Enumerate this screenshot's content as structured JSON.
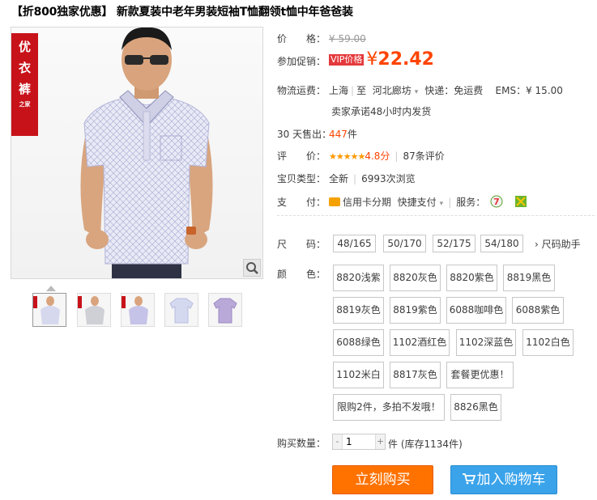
{
  "title": "【折800独家优惠】 新款夏装中老年男装短袖T恤翻领t恤中年爸爸装",
  "brand_tag": {
    "chars": [
      "优",
      "衣",
      "裤"
    ],
    "sub": "之家"
  },
  "price": {
    "label": "价　　格：",
    "original": "¥ 59.00"
  },
  "promo": {
    "label": "参加促销：",
    "badge": "VIP价格",
    "currency": "¥",
    "value": "22.42"
  },
  "logistics": {
    "label": "物流运费：",
    "from": "上海",
    "to_label": "至",
    "to": "河北廊坊",
    "express": "快递：免运费",
    "ems": "EMS：¥ 15.00",
    "promise": "卖家承诺48小时内发货"
  },
  "sales": {
    "label": "30 天售出：",
    "count": "447",
    "unit": "件"
  },
  "rating": {
    "label": "评　　价：",
    "stars": "★★★★★",
    "score": "4.8分",
    "reviews": "87条评价"
  },
  "type": {
    "label": "宝贝类型：",
    "value": "全新",
    "views": "6993次浏览"
  },
  "payment": {
    "label": "支　　付：",
    "credit": "信用卡分期",
    "quick": "快捷支付",
    "service_label": "服务："
  },
  "size": {
    "label": "尺　　码：",
    "options": [
      "48/165",
      "50/170",
      "52/175",
      "54/180"
    ],
    "helper": "› 尺码助手"
  },
  "color": {
    "label": "颜　　色：",
    "options": [
      "8820浅紫",
      "8820灰色",
      "8820紫色",
      "8819黑色",
      "8819灰色",
      "8819紫色",
      "6088咖啡色",
      "6088紫色",
      "6088绿色",
      "1102酒红色",
      "1102深蓝色",
      "1102白色",
      "1102米白",
      "8817灰色",
      "套餐更优惠！",
      "限购2件，多拍不发哦！",
      "8826黑色"
    ]
  },
  "quantity": {
    "label": "购买数量：",
    "value": "1",
    "minus": "-",
    "plus": "+",
    "unit": "件",
    "stock": "(库存1134件)"
  },
  "buttons": {
    "buy": "立刻购买",
    "cart": "加入购物车"
  },
  "colors": {
    "accent": "#ff4400",
    "buy": "#ff7200",
    "cart": "#3aa3ea",
    "brand": "#c8121a"
  }
}
